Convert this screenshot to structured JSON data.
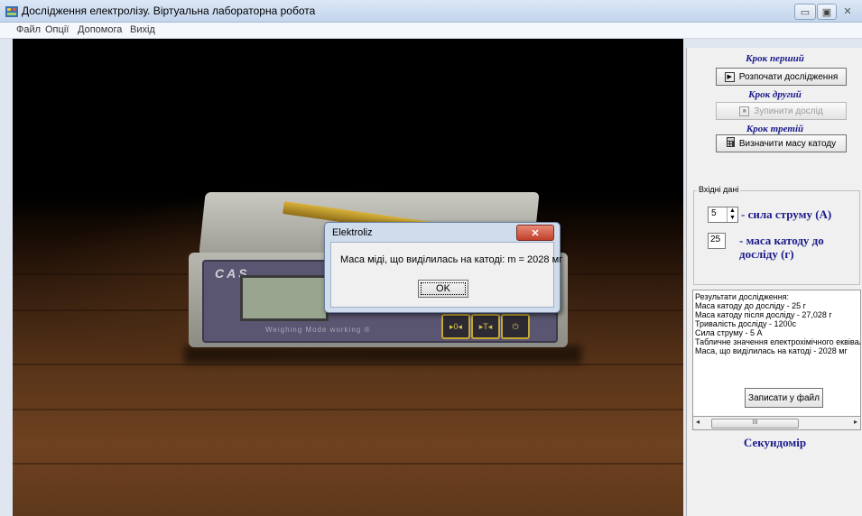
{
  "window": {
    "title": "Дослідження електролізу. Віртуальна лабораторна робота",
    "controls": {
      "minimize": "▭",
      "maximize": "▣",
      "close": "✕"
    }
  },
  "menu": [
    "Файл",
    "Опції",
    "Допомога",
    "Вихід"
  ],
  "scene": {
    "scale_brand": "CAS",
    "scale_caption": "Weighing Mode working ®",
    "scale_buttons": [
      "▸0◂",
      "▸T◂",
      "⏻"
    ]
  },
  "dialog": {
    "title": "Elektroliz",
    "close_icon": "✕",
    "message": "Маса міді, що виділилась на катоді:  m = 2028 мг",
    "ok_label": "OK"
  },
  "panel": {
    "step1_title": "Крок перший",
    "start_button": "Розпочати дослідження",
    "start_icon": "▶",
    "step2_title": "Крок другий",
    "stop_button": "Зупинити дослід",
    "stop_icon": "■",
    "step3_title": "Крок третій",
    "calc_button": "Визначити масу катоду",
    "calc_icon": "calculator-icon",
    "input_group": {
      "label": "Вхідні дані",
      "current_value": "5",
      "current_label": "- сила струму (А)",
      "mass_value": "25",
      "mass_label": "- маса катоду до досліду  (г)"
    },
    "results": {
      "lines": [
        "Результати дослідження:",
        "Маса катоду до досліду - 25 г",
        "Маса катоду після досліду - 27,028 г",
        "Тривалість досліду - 1200с",
        "Сила струму - 5 А",
        "Табличне значення електрохімічного еквівал",
        "Маса, що виділилась на катоді - 2028 мг"
      ],
      "save_button": "Записати у файл",
      "scroll_thumb": "III"
    },
    "stopwatch_label": "Секундомір"
  },
  "colors": {
    "accent_text": "#1a1a8c",
    "titlebar": "#c3d5ec",
    "dialog_close": "#c0402a"
  }
}
